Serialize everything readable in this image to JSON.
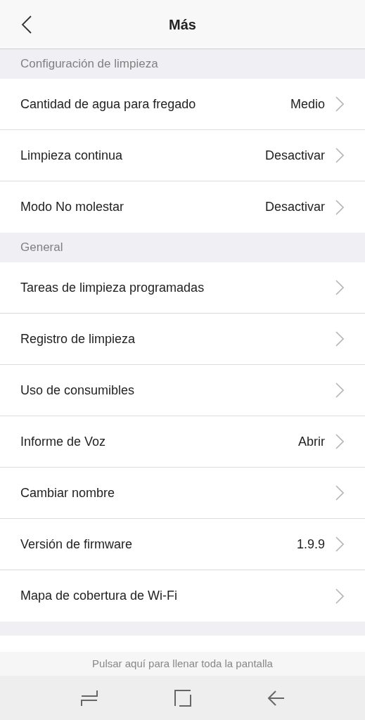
{
  "header": {
    "title": "Más"
  },
  "sections": [
    {
      "title": "Configuración de limpieza",
      "rows": [
        {
          "label": "Cantidad de agua para fregado",
          "value": "Medio"
        },
        {
          "label": "Limpieza continua",
          "value": "Desactivar"
        },
        {
          "label": "Modo No molestar",
          "value": "Desactivar"
        }
      ]
    },
    {
      "title": "General",
      "rows": [
        {
          "label": "Tareas de limpieza programadas"
        },
        {
          "label": "Registro de limpieza"
        },
        {
          "label": "Uso de consumibles"
        },
        {
          "label": "Informe de Voz",
          "value": "Abrir"
        },
        {
          "label": "Cambiar nombre"
        },
        {
          "label": "Versión de firmware",
          "value": "1.9.9"
        },
        {
          "label": "Mapa de cobertura de Wi-Fi"
        }
      ]
    }
  ],
  "fullscreen_hint": "Pulsar aquí para llenar toda la pantalla"
}
